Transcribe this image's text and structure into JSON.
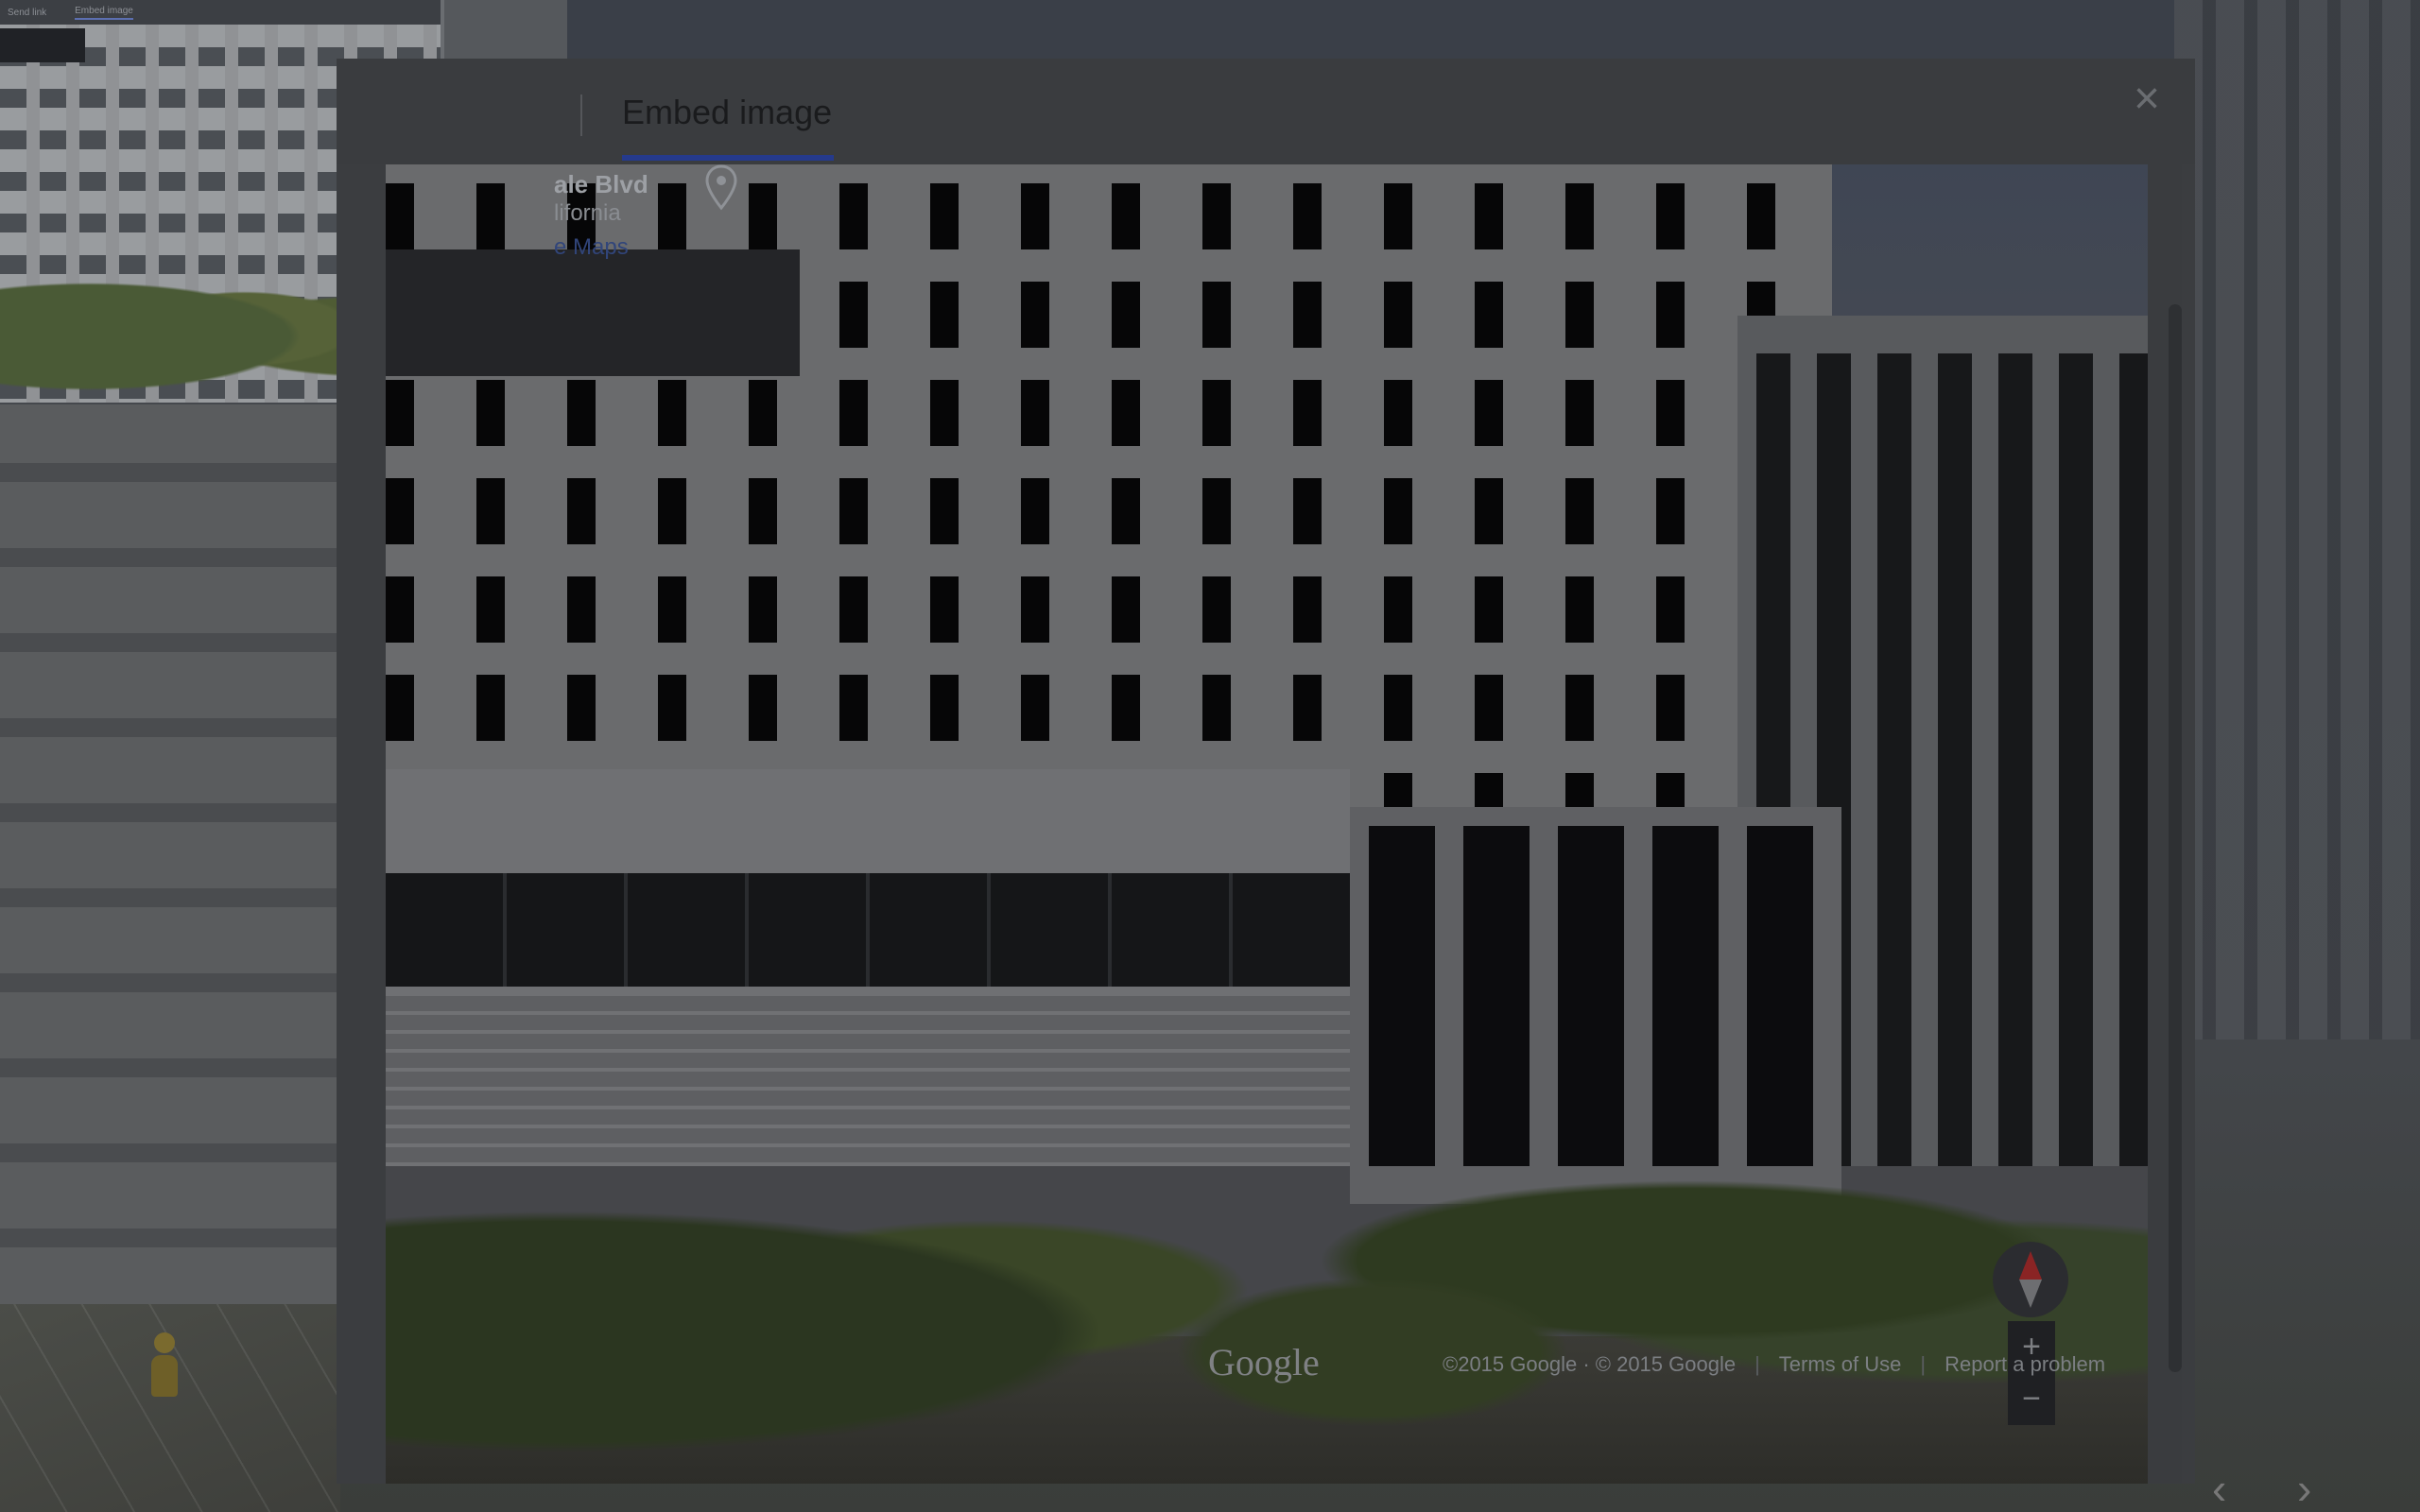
{
  "modal": {
    "tabs": [
      {
        "label": "Embed image",
        "active": true
      }
    ],
    "close_icon": "close-icon"
  },
  "street_view": {
    "address_line1": "ale Blvd",
    "address_line2": "lifornia",
    "maps_link": "e Maps",
    "pin_icon": "location-pin-icon",
    "watermark": "Google",
    "footer": {
      "copyright": "©2015 Google · © 2015 Google",
      "terms": "Terms of Use",
      "report": "Report a problem"
    },
    "zoom_in": "+",
    "zoom_out": "−"
  },
  "thumbnail": {
    "tabs": [
      "Send link",
      "Embed image"
    ]
  },
  "background": {
    "pegman_icon": "pegman-icon",
    "prev_arrow": "‹",
    "next_arrow": "›"
  },
  "colors": {
    "tab_underline": "#253a8c",
    "compass_north": "#8a2424"
  }
}
